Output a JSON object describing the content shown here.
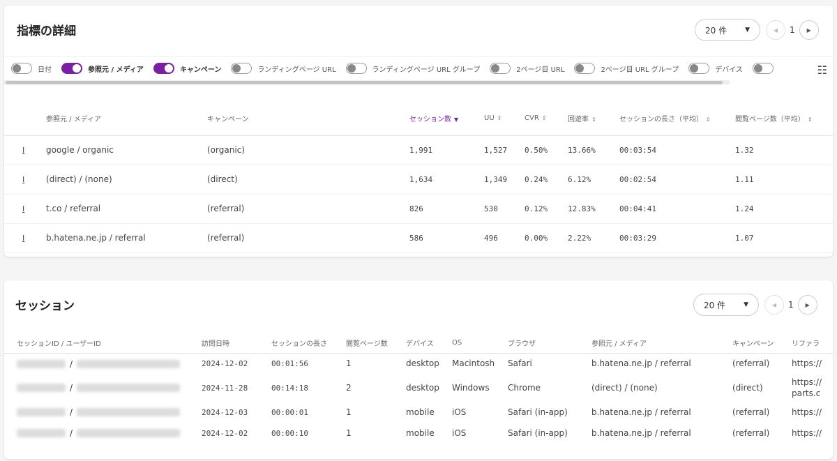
{
  "metrics": {
    "title": "指標の詳細",
    "per_page": "20 件",
    "page": "1",
    "toggles": [
      {
        "label": "日付",
        "on": false
      },
      {
        "label": "参照元 / メディア",
        "on": true
      },
      {
        "label": "キャンペーン",
        "on": true
      },
      {
        "label": "ランディングページ URL",
        "on": false
      },
      {
        "label": "ランディングページ URL グループ",
        "on": false
      },
      {
        "label": "2ページ目 URL",
        "on": false
      },
      {
        "label": "2ページ目 URL グループ",
        "on": false
      },
      {
        "label": "デバイス",
        "on": false
      }
    ],
    "columns": [
      "参照元 / メディア",
      "キャンペーン",
      "セッション数",
      "UU",
      "CVR",
      "回遊率",
      "セッションの長さ（平均）",
      "閲覧ページ数（平均）"
    ],
    "rows": [
      {
        "source": "google / organic",
        "campaign": "(organic)",
        "sessions": "1,991",
        "uu": "1,527",
        "cvr": "0.50%",
        "kaiyu": "13.66%",
        "length": "00:03:54",
        "pages": "1.32"
      },
      {
        "source": "(direct) / (none)",
        "campaign": "(direct)",
        "sessions": "1,634",
        "uu": "1,349",
        "cvr": "0.24%",
        "kaiyu": "6.12%",
        "length": "00:02:54",
        "pages": "1.11"
      },
      {
        "source": "t.co / referral",
        "campaign": "(referral)",
        "sessions": "826",
        "uu": "530",
        "cvr": "0.12%",
        "kaiyu": "12.83%",
        "length": "00:04:41",
        "pages": "1.24"
      },
      {
        "source": "b.hatena.ne.jp / referral",
        "campaign": "(referral)",
        "sessions": "586",
        "uu": "496",
        "cvr": "0.00%",
        "kaiyu": "2.22%",
        "length": "00:03:29",
        "pages": "1.07"
      }
    ]
  },
  "sessions": {
    "title": "セッション",
    "per_page": "20 件",
    "page": "1",
    "columns": [
      "セッションID / ユーザーID",
      "訪問日時",
      "セッションの長さ",
      "閲覧ページ数",
      "デバイス",
      "OS",
      "ブラウザ",
      "参照元 / メディア",
      "キャンペーン",
      "リファラ"
    ],
    "id_separator": "/",
    "rows": [
      {
        "date": "2024-12-02",
        "length": "00:01:56",
        "pages": "1",
        "device": "desktop",
        "os": "Macintosh",
        "browser": "Safari",
        "source": "b.hatena.ne.jp / referral",
        "campaign": "(referral)",
        "referrer": "https://"
      },
      {
        "date": "2024-11-28",
        "length": "00:14:18",
        "pages": "2",
        "device": "desktop",
        "os": "Windows",
        "browser": "Chrome",
        "source": "(direct) / (none)",
        "campaign": "(direct)",
        "referrer": "https://",
        "referrer2": "parts.c"
      },
      {
        "date": "2024-12-03",
        "length": "00:00:01",
        "pages": "1",
        "device": "mobile",
        "os": "iOS",
        "browser": "Safari (in-app)",
        "source": "b.hatena.ne.jp / referral",
        "campaign": "(referral)",
        "referrer": "https://"
      },
      {
        "date": "2024-12-02",
        "length": "00:00:10",
        "pages": "1",
        "device": "mobile",
        "os": "iOS",
        "browser": "Safari (in-app)",
        "source": "b.hatena.ne.jp / referral",
        "campaign": "(referral)",
        "referrer": "https://"
      }
    ]
  },
  "colors": {
    "accent": "#7b1fa2"
  }
}
